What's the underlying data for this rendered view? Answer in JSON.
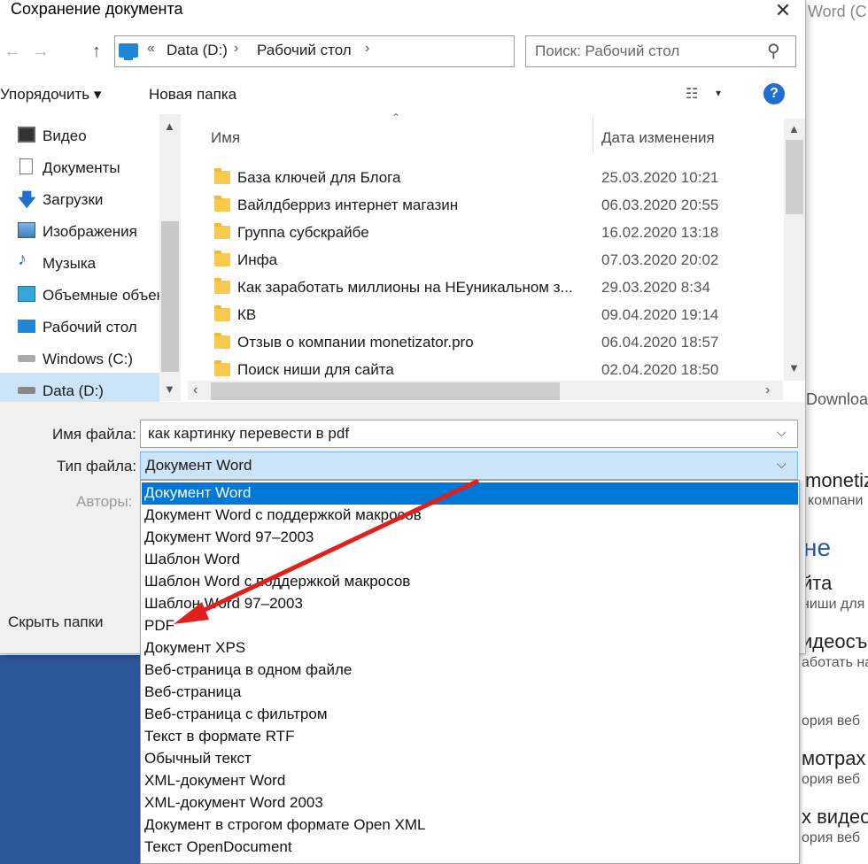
{
  "background_window": {
    "title_fragment": "Word (C",
    "download_fragment": "Downloa",
    "heading_fragment": "не",
    "items": [
      {
        "title": "monetiz",
        "subtitle": "компани"
      },
      {
        "title": "йта",
        "subtitle": "ниши для с"
      },
      {
        "title": "идеосъ",
        "subtitle": "аботать на"
      },
      {
        "title": "",
        "subtitle": "ория веб"
      },
      {
        "title": "мотрах в",
        "subtitle": "ория веб"
      },
      {
        "title": "х видео",
        "subtitle": "ория веб"
      }
    ]
  },
  "dialog": {
    "title": "Сохранение документа",
    "close_glyph": "✕",
    "address": {
      "separator": "«",
      "crumbs": [
        "Data (D:)",
        "Рабочий стол"
      ],
      "chevron": "›"
    },
    "search_placeholder": "Поиск: Рабочий стол",
    "toolbar": {
      "organize_label": "Упорядочить ▾",
      "new_folder_label": "Новая папка",
      "help_glyph": "?"
    },
    "nav_items": [
      {
        "label": "Видео",
        "icon": "video-icon"
      },
      {
        "label": "Документы",
        "icon": "documents-icon"
      },
      {
        "label": "Загрузки",
        "icon": "downloads-icon"
      },
      {
        "label": "Изображения",
        "icon": "pictures-icon"
      },
      {
        "label": "Музыка",
        "icon": "music-icon"
      },
      {
        "label": "Объемные объекты",
        "icon": "3d-objects-icon"
      },
      {
        "label": "Рабочий стол",
        "icon": "desktop-icon"
      },
      {
        "label": "Windows (C:)",
        "icon": "drive-c-icon"
      },
      {
        "label": "Data (D:)",
        "icon": "drive-d-icon"
      }
    ],
    "columns": {
      "name": "Имя",
      "date": "Дата изменения"
    },
    "files": [
      {
        "name": "База ключей для Блога",
        "date": "25.03.2020 10:21"
      },
      {
        "name": "Вайлдберриз интернет магазин",
        "date": "06.03.2020 20:55"
      },
      {
        "name": "Группа субскрайбе",
        "date": "16.02.2020 13:18"
      },
      {
        "name": "Инфа",
        "date": "07.03.2020 20:02"
      },
      {
        "name": "Как заработать миллионы на НЕуникальном з...",
        "date": "29.03.2020 8:34"
      },
      {
        "name": "КВ",
        "date": "09.04.2020 19:14"
      },
      {
        "name": "Отзыв о компании monetizator.pro",
        "date": "06.04.2020 18:57"
      },
      {
        "name": "Поиск ниши для сайта",
        "date": "02.04.2020 18:50"
      }
    ],
    "fields": {
      "filename_label": "Имя файла:",
      "filename_value": "как картинку перевести в pdf",
      "filetype_label": "Тип файла:",
      "filetype_value": "Документ Word",
      "authors_label": "Авторы:"
    },
    "hide_folders_label": "Скрыть папки",
    "filetype_options": [
      "Документ Word",
      "Документ Word с поддержкой макросов",
      "Документ Word 97–2003",
      "Шаблон Word",
      "Шаблон Word с поддержкой макросов",
      "Шаблон Word 97–2003",
      "PDF",
      "Документ XPS",
      "Веб-страница в одном файле",
      "Веб-страница",
      "Веб-страница с фильтром",
      "Текст в формате RTF",
      "Обычный текст",
      "XML-документ Word",
      "XML-документ Word 2003",
      "Документ в строгом формате Open XML",
      "Текст OpenDocument"
    ],
    "selected_option_index": 0
  },
  "colors": {
    "selection": "#0078d7",
    "hover_light": "#cce4f7",
    "annotation_arrow": "#e0201c",
    "word_blue": "#2b579a"
  }
}
